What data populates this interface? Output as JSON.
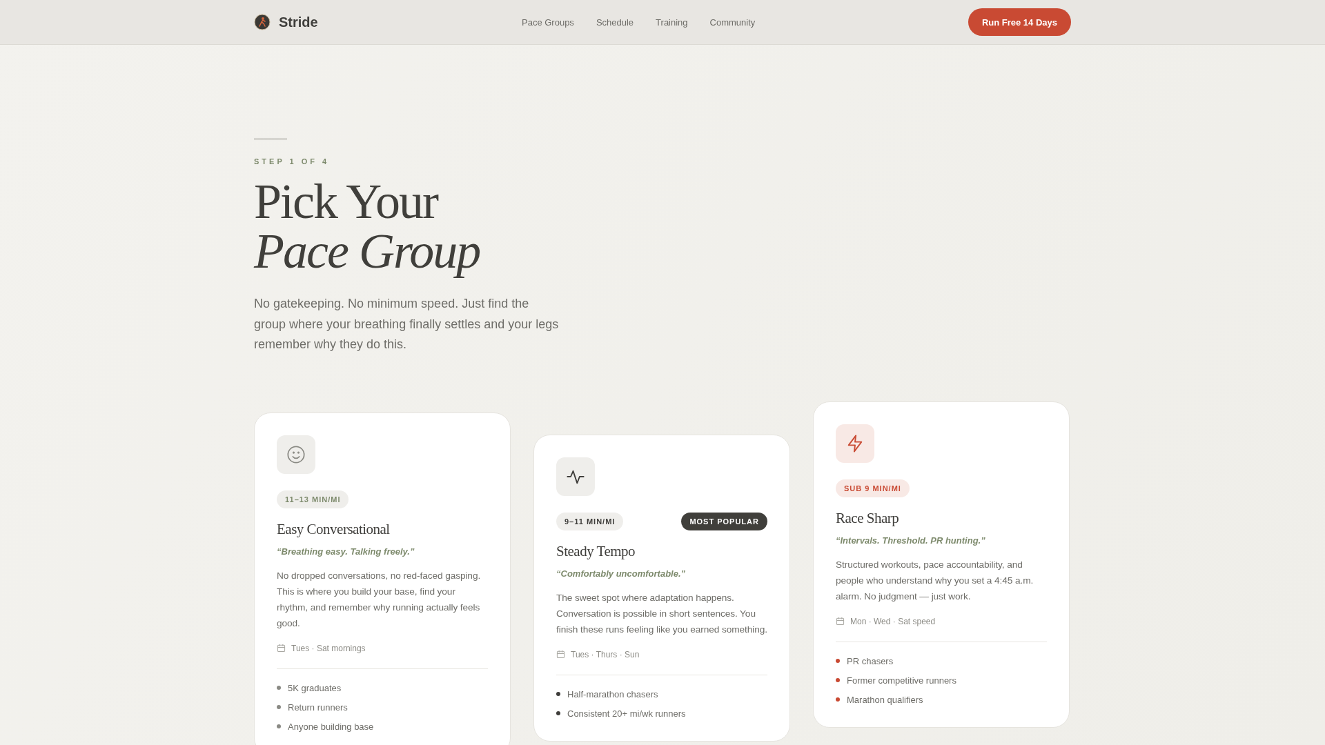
{
  "header": {
    "brand": "Stride",
    "nav": [
      {
        "label": "Pace Groups"
      },
      {
        "label": "Schedule"
      },
      {
        "label": "Training"
      },
      {
        "label": "Community"
      }
    ],
    "cta": "Run Free 14 Days"
  },
  "hero": {
    "eyebrow": "STEP 1 OF 4",
    "title_line_1": "Pick Your",
    "title_line_2": "Pace Group",
    "intro": "No gatekeeping. No minimum speed. Just find the group where your breathing finally settles and your legs remember why they do this."
  },
  "cards": [
    {
      "kind": "easy",
      "pace": "11–13 MIN/MI",
      "name": "Easy Conversational",
      "tagline": "“Breathing easy. Talking freely.”",
      "description": "No dropped conversations, no red-faced gasping. This is where you build your base, find your rhythm, and remember why running actually feels good.",
      "schedule": "Tues · Sat mornings",
      "audience": [
        "5K graduates",
        "Return runners",
        "Anyone building base"
      ]
    },
    {
      "kind": "tempo",
      "pace": "9–11 MIN/MI",
      "badge": "MOST POPULAR",
      "name": "Steady Tempo",
      "tagline": "“Comfortably uncomfortable.”",
      "description": "The sweet spot where adaptation happens. Conversation is possible in short sentences. You finish these runs feeling like you earned something.",
      "schedule": "Tues · Thurs · Sun",
      "audience": [
        "Half-marathon chasers",
        "Consistent 20+ mi/wk runners"
      ]
    },
    {
      "kind": "race",
      "pace": "SUB 9 MIN/MI",
      "name": "Race Sharp",
      "tagline": "“Intervals. Threshold. PR hunting.”",
      "description": "Structured workouts, pace accountability, and people who understand why you set a 4:45 a.m. alarm. No judgment — just work.",
      "schedule": "Mon · Wed · Sat speed",
      "audience": [
        "PR chasers",
        "Former competitive runners",
        "Marathon qualifiers"
      ]
    }
  ]
}
